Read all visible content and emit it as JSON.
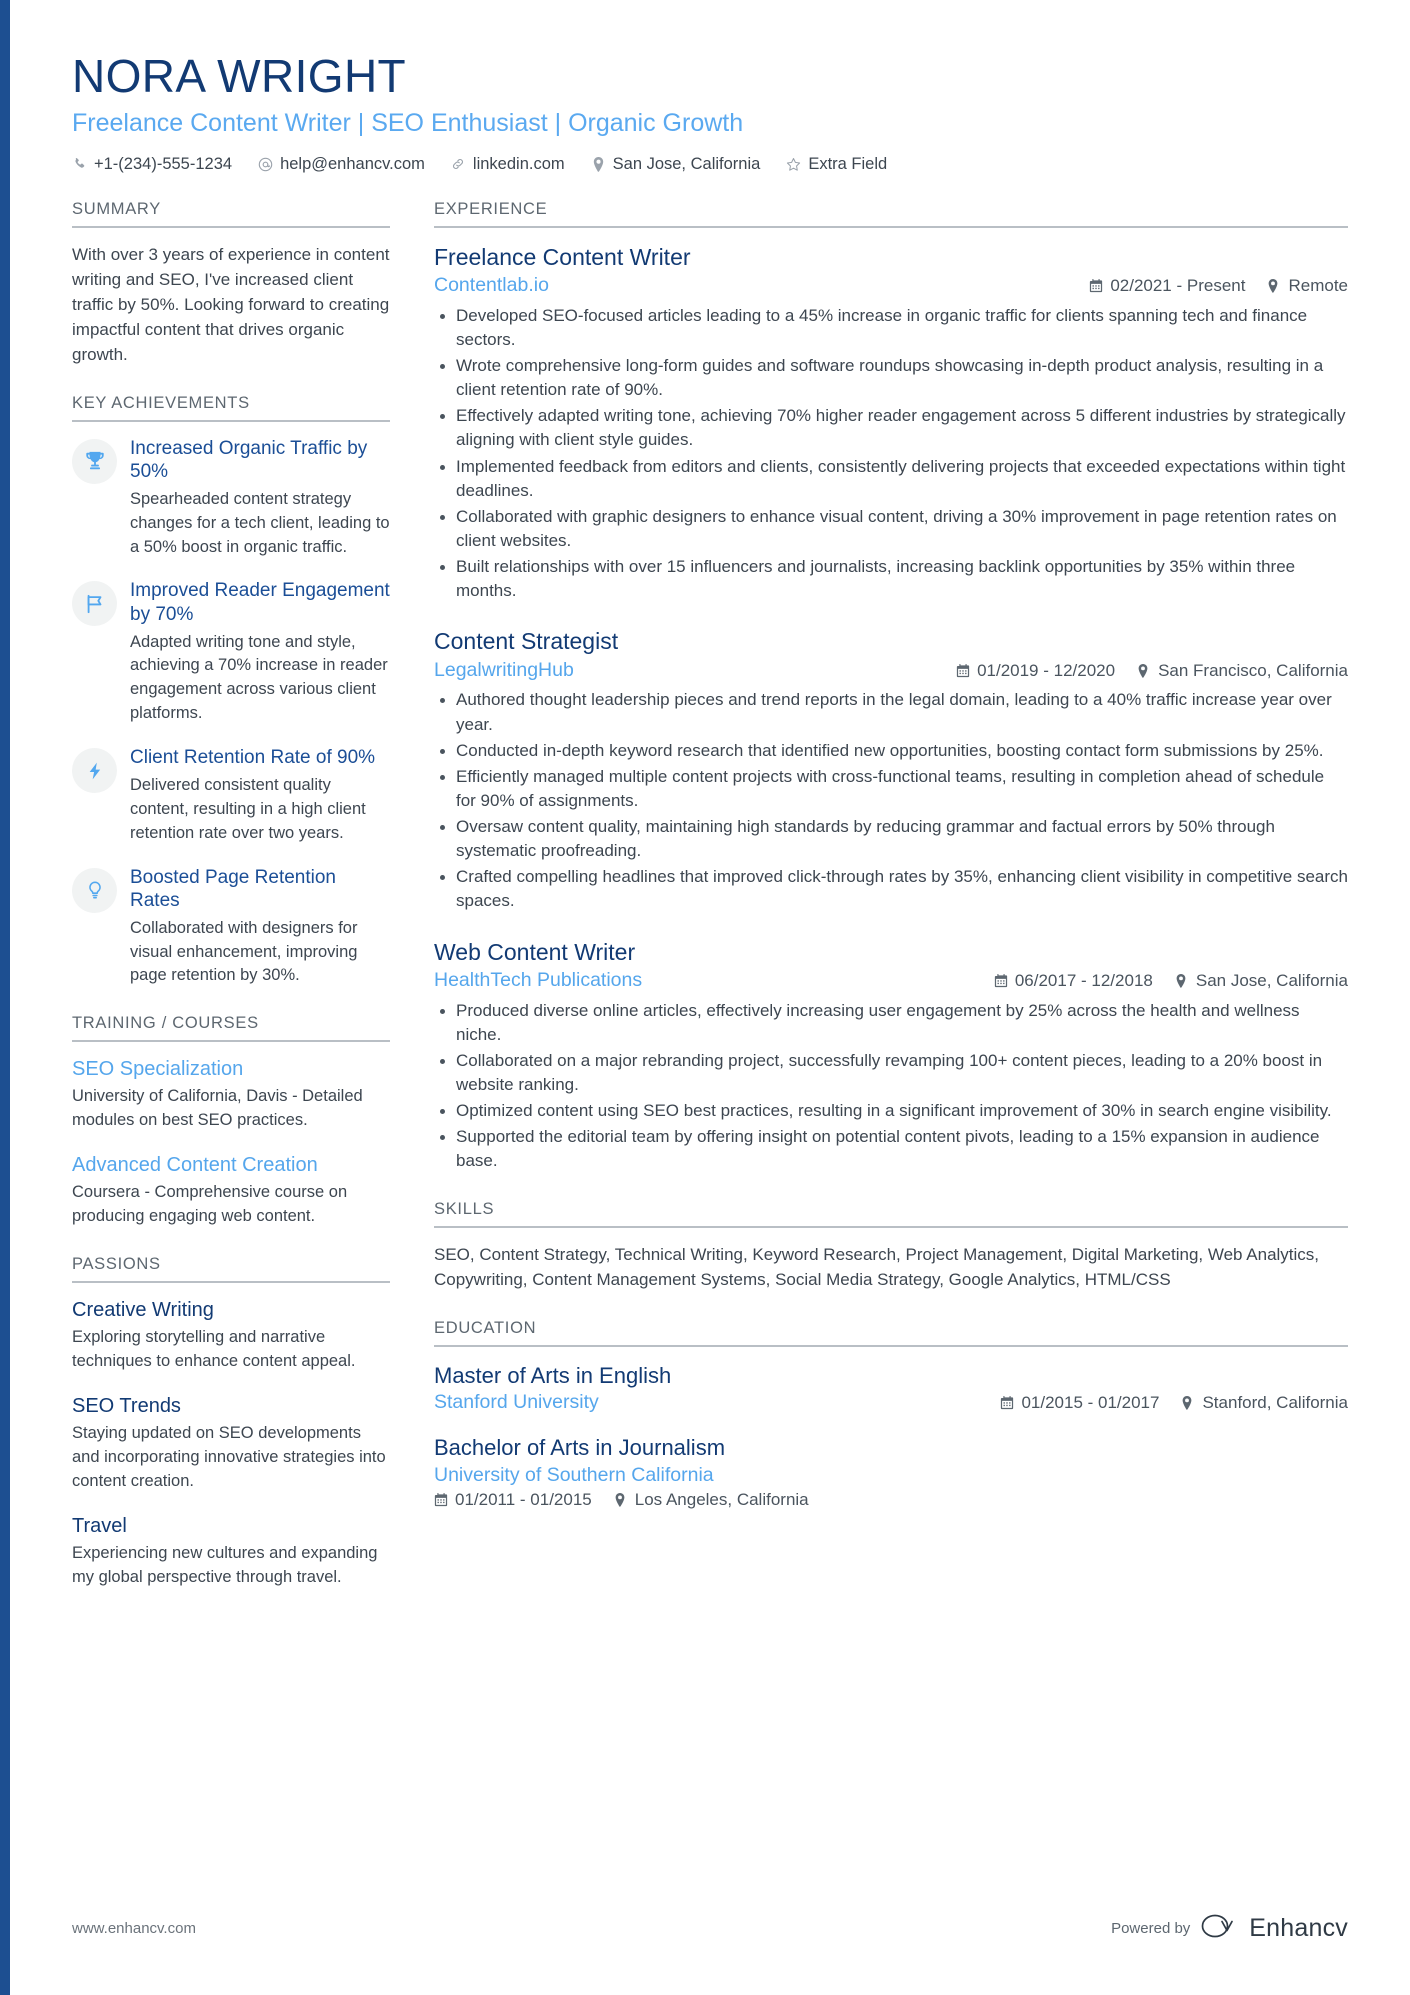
{
  "header": {
    "name": "NORA WRIGHT",
    "headline": "Freelance Content Writer | SEO Enthusiast | Organic Growth",
    "contacts": [
      {
        "icon": "phone-icon",
        "text": "+1-(234)-555-1234"
      },
      {
        "icon": "email-icon",
        "text": "help@enhancv.com"
      },
      {
        "icon": "link-icon",
        "text": "linkedin.com"
      },
      {
        "icon": "location-pin-icon",
        "text": "San Jose, California"
      },
      {
        "icon": "star-icon",
        "text": "Extra Field"
      }
    ]
  },
  "left": {
    "summary": {
      "title": "SUMMARY",
      "text": "With over 3 years of experience in content writing and SEO, I've increased client traffic by 50%. Looking forward to creating impactful content that drives organic growth."
    },
    "achievements": {
      "title": "KEY ACHIEVEMENTS",
      "items": [
        {
          "icon": "trophy-icon",
          "title": "Increased Organic Traffic by 50%",
          "desc": "Spearheaded content strategy changes for a tech client, leading to a 50% boost in organic traffic."
        },
        {
          "icon": "flag-icon",
          "title": "Improved Reader Engagement by 70%",
          "desc": "Adapted writing tone and style, achieving a 70% increase in reader engagement across various client platforms."
        },
        {
          "icon": "lightning-bolt-icon",
          "title": "Client Retention Rate of 90%",
          "desc": "Delivered consistent quality content, resulting in a high client retention rate over two years."
        },
        {
          "icon": "lightbulb-icon",
          "title": "Boosted Page Retention Rates",
          "desc": "Collaborated with designers for visual enhancement, improving page retention by 30%."
        }
      ]
    },
    "training": {
      "title": "TRAINING / COURSES",
      "items": [
        {
          "title": "SEO Specialization",
          "desc": "University of California, Davis - Detailed modules on best SEO practices."
        },
        {
          "title": "Advanced Content Creation",
          "desc": "Coursera - Comprehensive course on producing engaging web content."
        }
      ]
    },
    "passions": {
      "title": "PASSIONS",
      "items": [
        {
          "title": "Creative Writing",
          "desc": "Exploring storytelling and narrative techniques to enhance content appeal."
        },
        {
          "title": "SEO Trends",
          "desc": "Staying updated on SEO developments and incorporating innovative strategies into content creation."
        },
        {
          "title": "Travel",
          "desc": "Experiencing new cultures and expanding my global perspective through travel."
        }
      ]
    }
  },
  "right": {
    "experience": {
      "title": "EXPERIENCE",
      "jobs": [
        {
          "role": "Freelance Content Writer",
          "company": "Contentlab.io",
          "dates": "02/2021 - Present",
          "location": "Remote",
          "bullets": [
            "Developed SEO-focused articles leading to a 45% increase in organic traffic for clients spanning tech and finance sectors.",
            "Wrote comprehensive long-form guides and software roundups showcasing in-depth product analysis, resulting in a client retention rate of 90%.",
            "Effectively adapted writing tone, achieving 70% higher reader engagement across 5 different industries by strategically aligning with client style guides.",
            "Implemented feedback from editors and clients, consistently delivering projects that exceeded expectations within tight deadlines.",
            "Collaborated with graphic designers to enhance visual content, driving a 30% improvement in page retention rates on client websites.",
            "Built relationships with over 15 influencers and journalists, increasing backlink opportunities by 35% within three months."
          ]
        },
        {
          "role": "Content Strategist",
          "company": "LegalwritingHub",
          "dates": "01/2019 - 12/2020",
          "location": "San Francisco, California",
          "bullets": [
            "Authored thought leadership pieces and trend reports in the legal domain, leading to a 40% traffic increase year over year.",
            "Conducted in-depth keyword research that identified new opportunities, boosting contact form submissions by 25%.",
            "Efficiently managed multiple content projects with cross-functional teams, resulting in completion ahead of schedule for 90% of assignments.",
            "Oversaw content quality, maintaining high standards by reducing grammar and factual errors by 50% through systematic proofreading.",
            "Crafted compelling headlines that improved click-through rates by 35%, enhancing client visibility in competitive search spaces."
          ]
        },
        {
          "role": "Web Content Writer",
          "company": "HealthTech Publications",
          "dates": "06/2017 - 12/2018",
          "location": "San Jose, California",
          "bullets": [
            "Produced diverse online articles, effectively increasing user engagement by 25% across the health and wellness niche.",
            "Collaborated on a major rebranding project, successfully revamping 100+ content pieces, leading to a 20% boost in website ranking.",
            "Optimized content using SEO best practices, resulting in a significant improvement of 30% in search engine visibility.",
            "Supported the editorial team by offering insight on potential content pivots, leading to a 15% expansion in audience base."
          ]
        }
      ]
    },
    "skills": {
      "title": "SKILLS",
      "text": "SEO, Content Strategy, Technical Writing, Keyword Research, Project Management, Digital Marketing, Web Analytics, Copywriting, Content Management Systems, Social Media Strategy, Google Analytics, HTML/CSS"
    },
    "education": {
      "title": "EDUCATION",
      "items": [
        {
          "degree": "Master of Arts in English",
          "school": "Stanford University",
          "dates": "01/2015 - 01/2017",
          "location": "Stanford, California",
          "stacked": false
        },
        {
          "degree": "Bachelor of Arts in Journalism",
          "school": "University of Southern California",
          "dates": "01/2011 - 01/2015",
          "location": "Los Angeles, California",
          "stacked": true
        }
      ]
    }
  },
  "footer": {
    "website": "www.enhancv.com",
    "powered_by": "Powered by",
    "brand": "Enhancv"
  },
  "colors": {
    "navy": "#123a73",
    "light_blue": "#55a6ec",
    "body_gray": "#3d4650",
    "rule_gray": "#b9bfc5",
    "icon_gray": "#9aa2ab"
  }
}
